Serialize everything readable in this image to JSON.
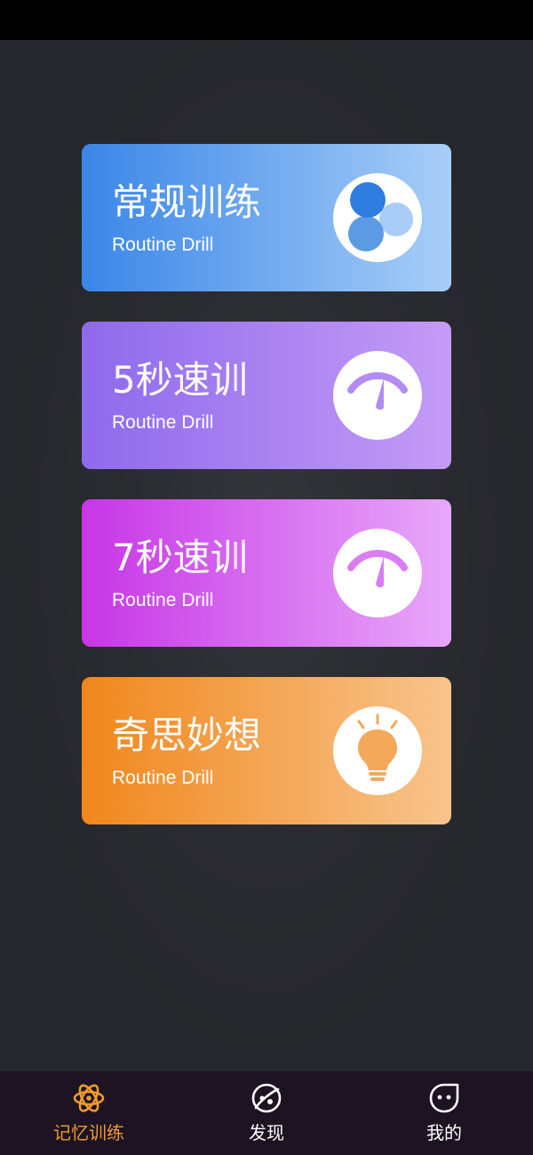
{
  "cards": [
    {
      "title": "常规训练",
      "subtitle": "Routine Drill",
      "icon": "bubbles-icon",
      "gradient": [
        "#3a86e8",
        "#a8cef7"
      ]
    },
    {
      "title": "5秒速训",
      "subtitle": "Routine Drill",
      "icon": "speedometer-icon",
      "gradient": [
        "#8e6aec",
        "#c49bf6"
      ]
    },
    {
      "title": "7秒速训",
      "subtitle": "Routine Drill",
      "icon": "speedometer-icon",
      "gradient": [
        "#c736e6",
        "#e7a8fa"
      ]
    },
    {
      "title": "奇思妙想",
      "subtitle": "Routine Drill",
      "icon": "lightbulb-icon",
      "gradient": [
        "#f0871c",
        "#f8c48c"
      ]
    }
  ],
  "tabbar": {
    "items": [
      {
        "label": "记忆训练",
        "icon": "atom-icon",
        "active": true
      },
      {
        "label": "发现",
        "icon": "planet-icon",
        "active": false
      },
      {
        "label": "我的",
        "icon": "face-icon",
        "active": false
      }
    ],
    "active_color": "#f09a2e",
    "inactive_color": "#ffffff"
  }
}
